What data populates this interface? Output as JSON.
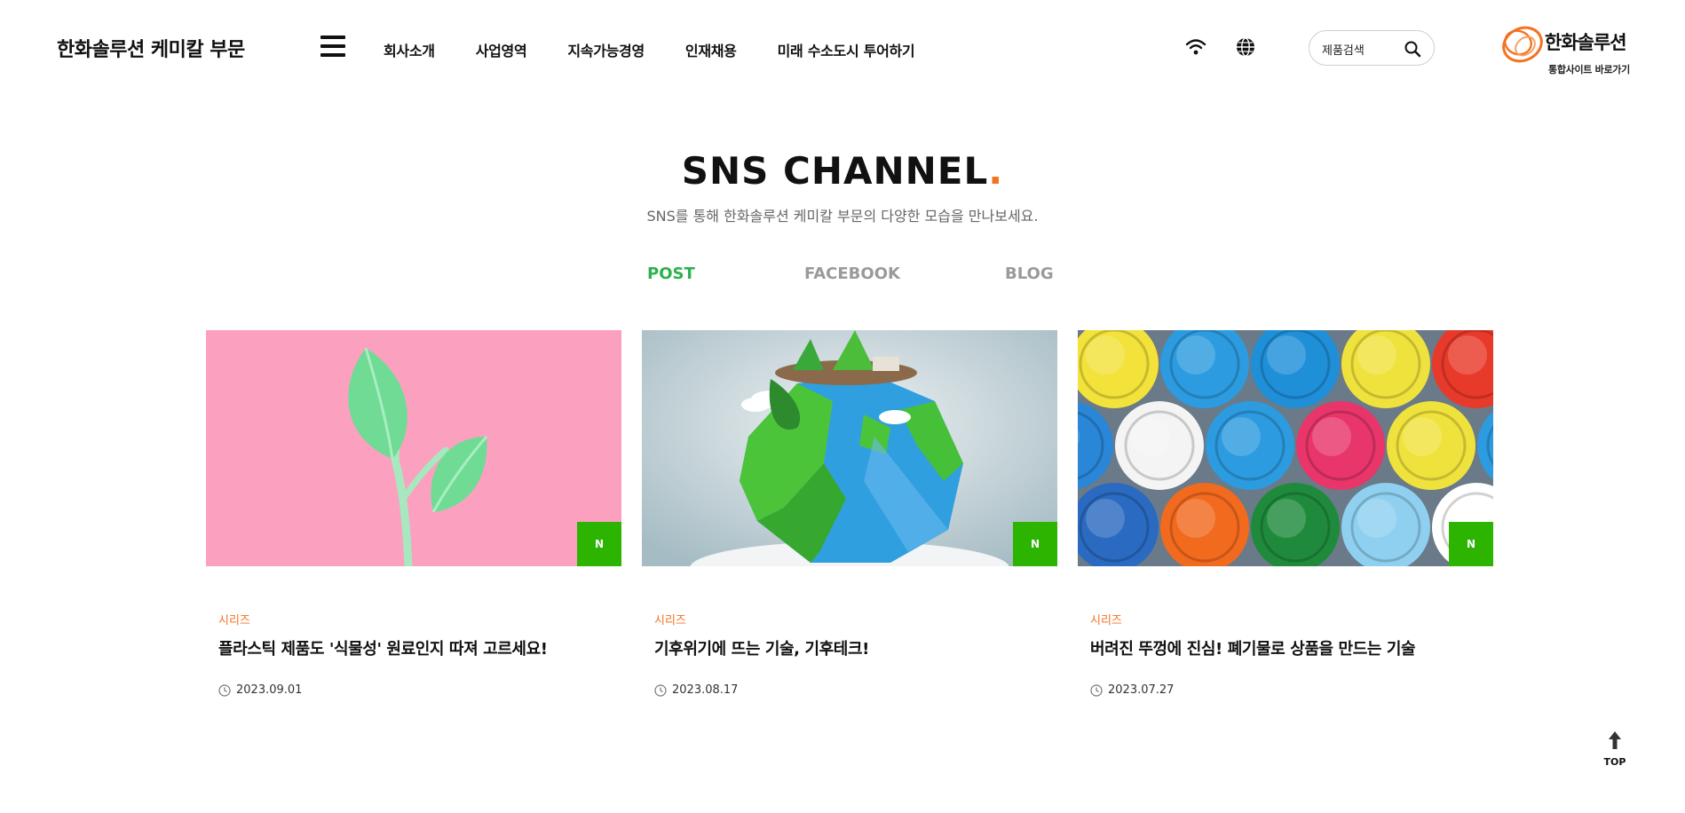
{
  "header": {
    "brand": "한화솔루션 케미칼 부문",
    "nav": [
      "회사소개",
      "사업영역",
      "지속가능경영",
      "인재채용",
      "미래 수소도시 투어하기"
    ],
    "search_label": "제품검색",
    "logo_name": "한화솔루션",
    "logo_sub": "통합사이트 바로가기",
    "icons": [
      "menu-icon",
      "wifi-icon",
      "globe-icon",
      "search-icon"
    ],
    "accent": "#f37321"
  },
  "section": {
    "title": "SNS CHANNEL",
    "title_dot": ".",
    "subtitle": "SNS를 통해 한화솔루션 케미칼 부문의 다양한 모습을 만나보세요."
  },
  "tabs": [
    {
      "label": "POST",
      "active": true
    },
    {
      "label": "FACEBOOK",
      "active": false
    },
    {
      "label": "BLOG",
      "active": false
    }
  ],
  "tab_active_color": "#2bb24c",
  "cards": [
    {
      "category": "시리즈",
      "title": "플라스틱 제품도 '식물성' 원료인지 따져 고르세요!",
      "date": "2023.09.01",
      "badge": "N"
    },
    {
      "category": "시리즈",
      "title": "기후위기에 뜨는 기술, 기후테크!",
      "date": "2023.08.17",
      "badge": "N"
    },
    {
      "category": "시리즈",
      "title": "버려진 뚜껑에 진심! 폐기물로 상품을 만드는 기술",
      "date": "2023.07.27",
      "badge": "N"
    }
  ],
  "badge_color": "#2db400",
  "top_button": {
    "label": "TOP"
  }
}
